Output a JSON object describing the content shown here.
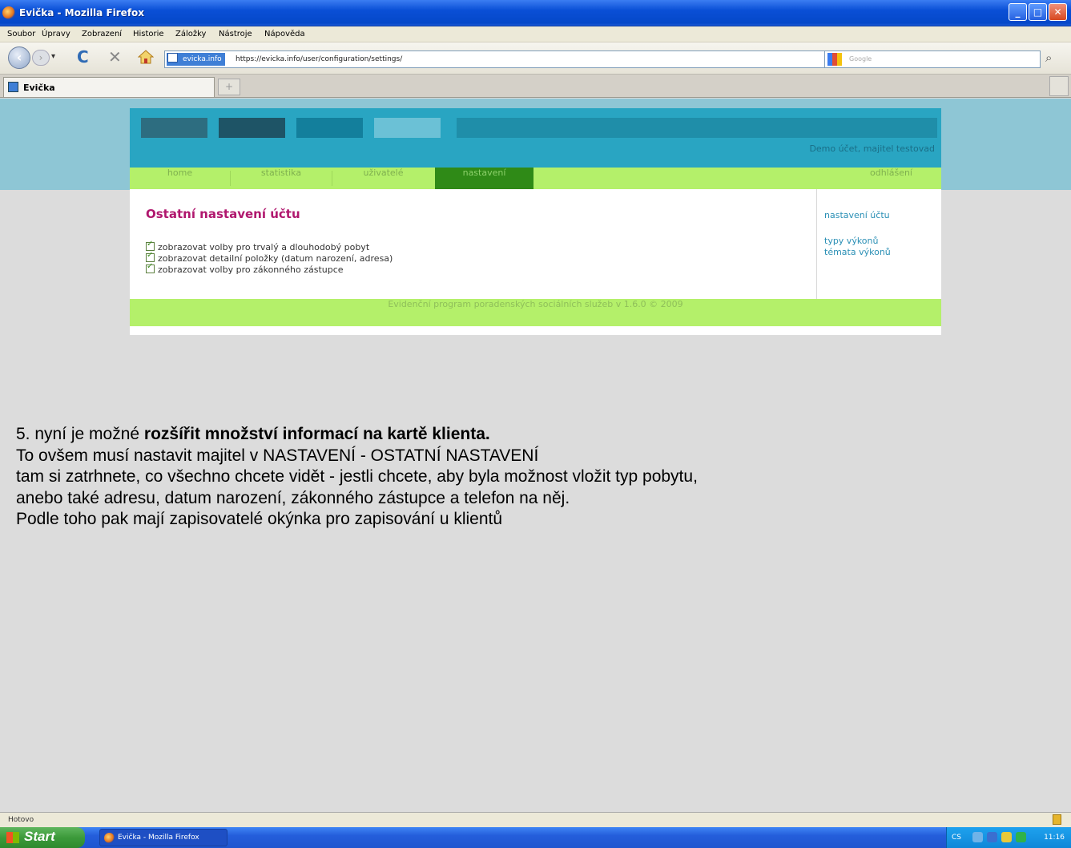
{
  "window": {
    "title": "Evička - Mozilla Firefox",
    "minimize": "_",
    "maximize": "□",
    "close": "✕"
  },
  "menu": [
    "Soubor",
    "Úpravy",
    "Zobrazení",
    "Historie",
    "Záložky",
    "Nástroje",
    "Nápověda"
  ],
  "navbar": {
    "back": "‹",
    "forward": "›",
    "dropdown": "▾",
    "reload": "C",
    "stop": "✕",
    "site_badge": "evicka.info",
    "url": "https://evicka.info/user/configuration/settings/",
    "bookmark_star": "☆",
    "star_dropdown": "▾",
    "search_placeholder": "Google",
    "search_button": "⌕"
  },
  "tabs": {
    "active_label": "Evička",
    "new_tab": "+"
  },
  "app": {
    "user_info": "Demo účet, majitel testovad",
    "nav": [
      "home",
      "statistika",
      "uživatelé",
      "nastavení",
      "odhlášení"
    ],
    "active_nav": "nastavení",
    "section_title": "Ostatní nastavení účtu",
    "options": [
      "zobrazovat volby pro trvalý a dlouhodobý pobyt",
      "zobrazovat detailní položky (datum narození, adresa)",
      "zobrazovat volby pro zákonného zástupce"
    ],
    "sidebar": [
      "nastavení účtu",
      "typy výkonů",
      "témata výkonů"
    ],
    "footer": "Evidenční program poradenských sociálních služeb v 1.6.0 © 2009"
  },
  "instructions": {
    "line1_prefix": "5.  nyní je možné ",
    "line1_bold": "rozšířit množství informací na kartě klienta.",
    "line2": "To ovšem musí nastavit majitel v NASTAVENÍ - OSTATNÍ NASTAVENÍ",
    "line3": "tam si zatrhnete, co všechno chcete vidět - jestli chcete,  aby byla možnost vložit typ pobytu,",
    "line4": "anebo  také adresu, datum narození, zákonného zástupce a telefon  na něj.",
    "line5": "Podle toho pak mají zapisovatelé okýnka pro zapisování u klientů"
  },
  "status": {
    "text": "Hotovo"
  },
  "taskbar": {
    "start": "Start",
    "task": "Evička - Mozilla Firefox",
    "lang": "CS",
    "time": "11:16"
  },
  "colors": {
    "header": "#29a5c2",
    "nav": "#b4f06a",
    "active_nav": "#2f8a17",
    "title": "#b0176e",
    "link": "#2a8fb5"
  }
}
